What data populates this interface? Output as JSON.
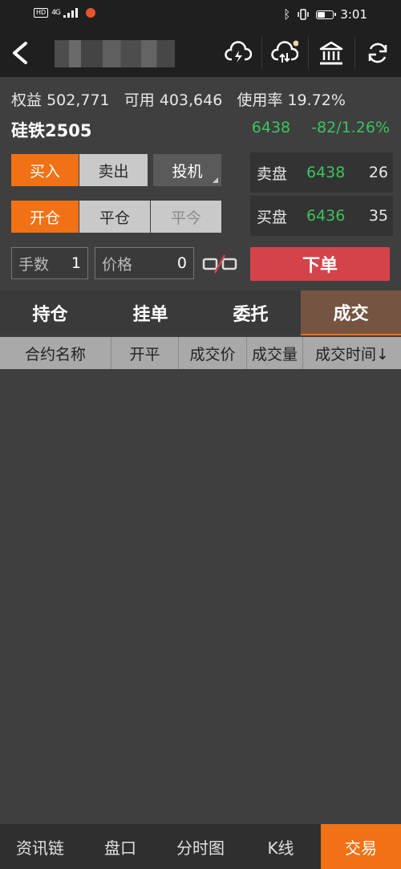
{
  "status_bar": {
    "network_badge": "HD",
    "network_type": "4G",
    "time": "3:01"
  },
  "account": {
    "equity_label": "权益",
    "equity_value": "502,771",
    "available_label": "可用",
    "available_value": "403,646",
    "usage_label": "使用率",
    "usage_value": "19.72%"
  },
  "contract": {
    "name": "硅铁2505",
    "last_price": "6438",
    "change": "-82/1.26%"
  },
  "direction": {
    "buy": "买入",
    "sell": "卖出"
  },
  "hedge_type": "投机",
  "offset": {
    "open": "开仓",
    "close": "平仓",
    "close_today": "平今"
  },
  "order_book": {
    "ask_label": "卖盘",
    "ask_price": "6438",
    "ask_qty": "26",
    "bid_label": "买盘",
    "bid_price": "6436",
    "bid_qty": "35"
  },
  "order_form": {
    "qty_label": "手数",
    "qty_value": "1",
    "price_label": "价格",
    "price_value": "0",
    "submit": "下单"
  },
  "tabs": [
    "持仓",
    "挂单",
    "委托",
    "成交"
  ],
  "active_tab": "成交",
  "table_headers": [
    "合约名称",
    "开平",
    "成交价",
    "成交量",
    "成交时间↓"
  ],
  "bottom_nav": [
    "资讯链",
    "盘口",
    "分时图",
    "K线",
    "交易"
  ],
  "colors": {
    "accent": "#f07214",
    "up_down_green": "#3cc35f",
    "order_red": "#d5434a"
  }
}
